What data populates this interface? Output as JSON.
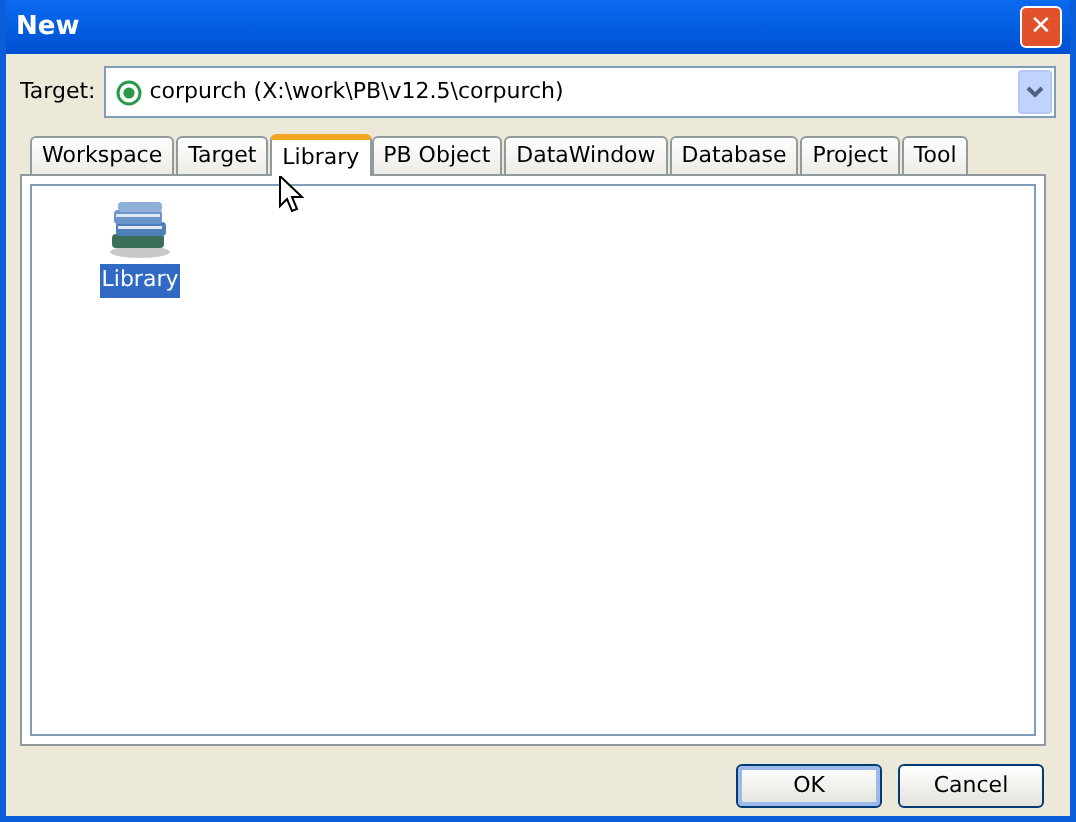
{
  "window": {
    "title": "New",
    "close": "✕"
  },
  "target": {
    "label": "Target:",
    "value": "corpurch (X:\\work\\PB\\v12.5\\corpurch)"
  },
  "tabs": [
    {
      "label": "Workspace",
      "selected": false
    },
    {
      "label": "Target",
      "selected": false
    },
    {
      "label": "Library",
      "selected": true
    },
    {
      "label": "PB Object",
      "selected": false
    },
    {
      "label": "DataWindow",
      "selected": false
    },
    {
      "label": "Database",
      "selected": false
    },
    {
      "label": "Project",
      "selected": false
    },
    {
      "label": "Tool",
      "selected": false
    }
  ],
  "items": [
    {
      "label": "Library",
      "selected": true
    }
  ],
  "buttons": [
    {
      "label": "OK",
      "default": true
    },
    {
      "label": "Cancel",
      "default": false
    }
  ]
}
